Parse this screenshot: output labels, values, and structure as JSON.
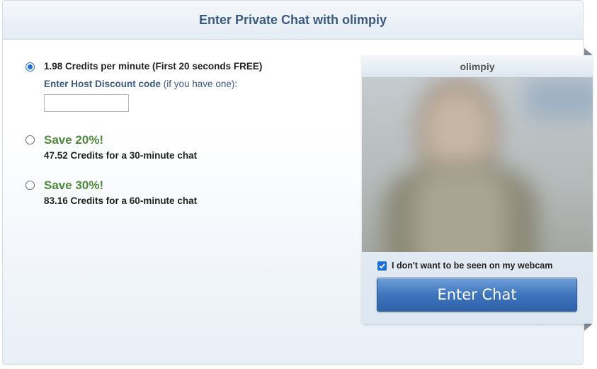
{
  "dialog": {
    "title": "Enter Private Chat with olimpiy"
  },
  "options": {
    "per_minute": {
      "label": "1.98 Credits per minute (First 20 seconds FREE)",
      "selected": true
    },
    "discount": {
      "label_bold": "Enter Host Discount code",
      "label_rest": " (if you have one):",
      "value": ""
    },
    "save20": {
      "title": "Save 20%!",
      "subtitle": "47.52 Credits for a 30-minute chat",
      "selected": false
    },
    "save30": {
      "title": "Save 30%!",
      "subtitle": "83.16 Credits for a 60-minute chat",
      "selected": false
    }
  },
  "cam": {
    "name": "olimpiy",
    "hide_webcam_label": "I don't want to be seen on my webcam",
    "hide_webcam_checked": true,
    "enter_button_label": "Enter Chat"
  },
  "colors": {
    "title": "#3b5a7e",
    "save_green": "#4e8a3c",
    "accent_blue": "#1a6ed8",
    "button_blue": "#3f75bd"
  }
}
